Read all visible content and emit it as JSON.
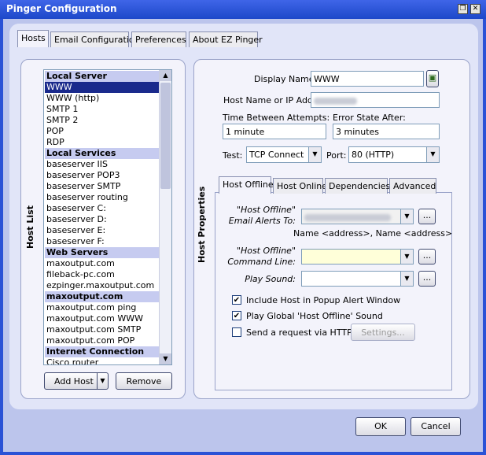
{
  "window": {
    "title": "Pinger Configuration",
    "restore_glyph": "❐",
    "close_glyph": "✕"
  },
  "tabs": [
    "Hosts",
    "Email Configuration",
    "Preferences",
    "About EZ Pinger"
  ],
  "host_list": {
    "label": "Host List",
    "items": [
      {
        "text": "Local Server",
        "type": "head"
      },
      {
        "text": "WWW",
        "type": "sel"
      },
      {
        "text": "WWW (http)",
        "type": "item"
      },
      {
        "text": "SMTP 1",
        "type": "item"
      },
      {
        "text": "SMTP 2",
        "type": "item"
      },
      {
        "text": "POP",
        "type": "item"
      },
      {
        "text": "RDP",
        "type": "item"
      },
      {
        "text": "Local Services",
        "type": "head"
      },
      {
        "text": "baseserver IIS",
        "type": "item"
      },
      {
        "text": "baseserver POP3",
        "type": "item"
      },
      {
        "text": "baseserver SMTP",
        "type": "item"
      },
      {
        "text": "baseserver routing",
        "type": "item"
      },
      {
        "text": "baseserver C:",
        "type": "item"
      },
      {
        "text": "baseserver D:",
        "type": "item"
      },
      {
        "text": "baseserver E:",
        "type": "item"
      },
      {
        "text": "baseserver F:",
        "type": "item"
      },
      {
        "text": "Web Servers",
        "type": "head"
      },
      {
        "text": "maxoutput.com",
        "type": "item"
      },
      {
        "text": "fileback-pc.com",
        "type": "item"
      },
      {
        "text": "ezpinger.maxoutput.com",
        "type": "item"
      },
      {
        "text": "maxoutput.com",
        "type": "head"
      },
      {
        "text": "maxoutput.com ping",
        "type": "item"
      },
      {
        "text": "maxoutput.com WWW",
        "type": "item"
      },
      {
        "text": "maxoutput.com SMTP",
        "type": "item"
      },
      {
        "text": "maxoutput.com POP",
        "type": "item"
      },
      {
        "text": "Internet Connection",
        "type": "head"
      },
      {
        "text": "Cisco router",
        "type": "item"
      }
    ],
    "add_host": "Add Host",
    "remove": "Remove"
  },
  "host_properties": {
    "label": "Host Properties",
    "display_name_label": "Display Name",
    "display_name_value": "WWW",
    "hostname_label": "Host Name or IP Addr",
    "time_between_label": "Time Between Attempts:",
    "time_between_value": "1 minute",
    "error_state_label": "Error State After:",
    "error_state_value": "3 minutes",
    "test_label": "Test:",
    "test_value": "TCP Connect",
    "port_label": "Port:",
    "port_value": "80 (HTTP)"
  },
  "sub_tabs": [
    "Host Offline",
    "Host Online",
    "Dependencies",
    "Advanced"
  ],
  "offline": {
    "email_label_1": "\"Host Offline\"",
    "email_label_2": "Email Alerts To:",
    "email_hint": "Name <address>, Name <address>",
    "cmd_label_1": "\"Host Offline\"",
    "cmd_label_2": "Command Line:",
    "sound_label": "Play Sound:",
    "ellipsis": "...",
    "chk_popup": "Include Host in Popup Alert Window",
    "chk_sound": "Play Global 'Host Offline' Sound",
    "chk_http": "Send a request via HTTP",
    "settings": "Settings..."
  },
  "footer": {
    "ok": "OK",
    "cancel": "Cancel"
  }
}
